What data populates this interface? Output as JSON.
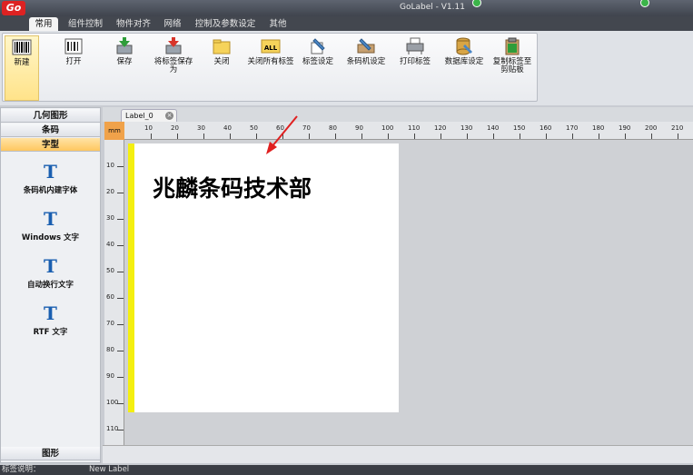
{
  "app": {
    "title": "GoLabel - V1.11",
    "logo_text": "Go"
  },
  "menu_tabs": [
    "常用",
    "组件控制",
    "物件对齐",
    "网络",
    "控制及参数设定",
    "其他"
  ],
  "ribbon": {
    "buttons": [
      {
        "label": "新建",
        "icon": "barcode-icon"
      },
      {
        "label": "打开",
        "icon": "open-icon"
      },
      {
        "label": "保存",
        "icon": "save-icon"
      },
      {
        "label": "将标签保存为",
        "icon": "save-as-icon"
      },
      {
        "label": "关闭",
        "icon": "folder-icon"
      },
      {
        "label": "关闭所有标签",
        "icon": "close-all-icon"
      },
      {
        "label": "标签设定",
        "icon": "label-settings-icon"
      },
      {
        "label": "条码机设定",
        "icon": "printer-settings-icon"
      },
      {
        "label": "打印标签",
        "icon": "print-icon"
      },
      {
        "label": "数据库设定",
        "icon": "database-icon"
      },
      {
        "label": "复制标签至剪贴板",
        "icon": "clipboard-icon"
      }
    ]
  },
  "left_panel": {
    "headers": [
      "几何图形",
      "条码",
      "字型"
    ],
    "items": [
      "条码机内建字体",
      "Windows 文字",
      "自动换行文字",
      "RTF 文字"
    ],
    "footer": "图形"
  },
  "document": {
    "tab_label": "Label_0",
    "ruler_unit": "mm",
    "ruler_h": [
      "10",
      "20",
      "30",
      "40",
      "50",
      "60",
      "70",
      "80",
      "90",
      "100",
      "110",
      "120",
      "130",
      "140",
      "150",
      "160",
      "170",
      "180",
      "190",
      "200",
      "210"
    ],
    "ruler_v": [
      "10",
      "20",
      "30",
      "40",
      "50",
      "60",
      "70",
      "80",
      "90",
      "100",
      "110"
    ],
    "label_text": "兆麟条码技术部"
  },
  "status": {
    "left": "标签说明：",
    "value": "New Label"
  },
  "colors": {
    "accent": "#ffc760",
    "label_margin": "#f4ef10",
    "arrow": "#e02020"
  }
}
